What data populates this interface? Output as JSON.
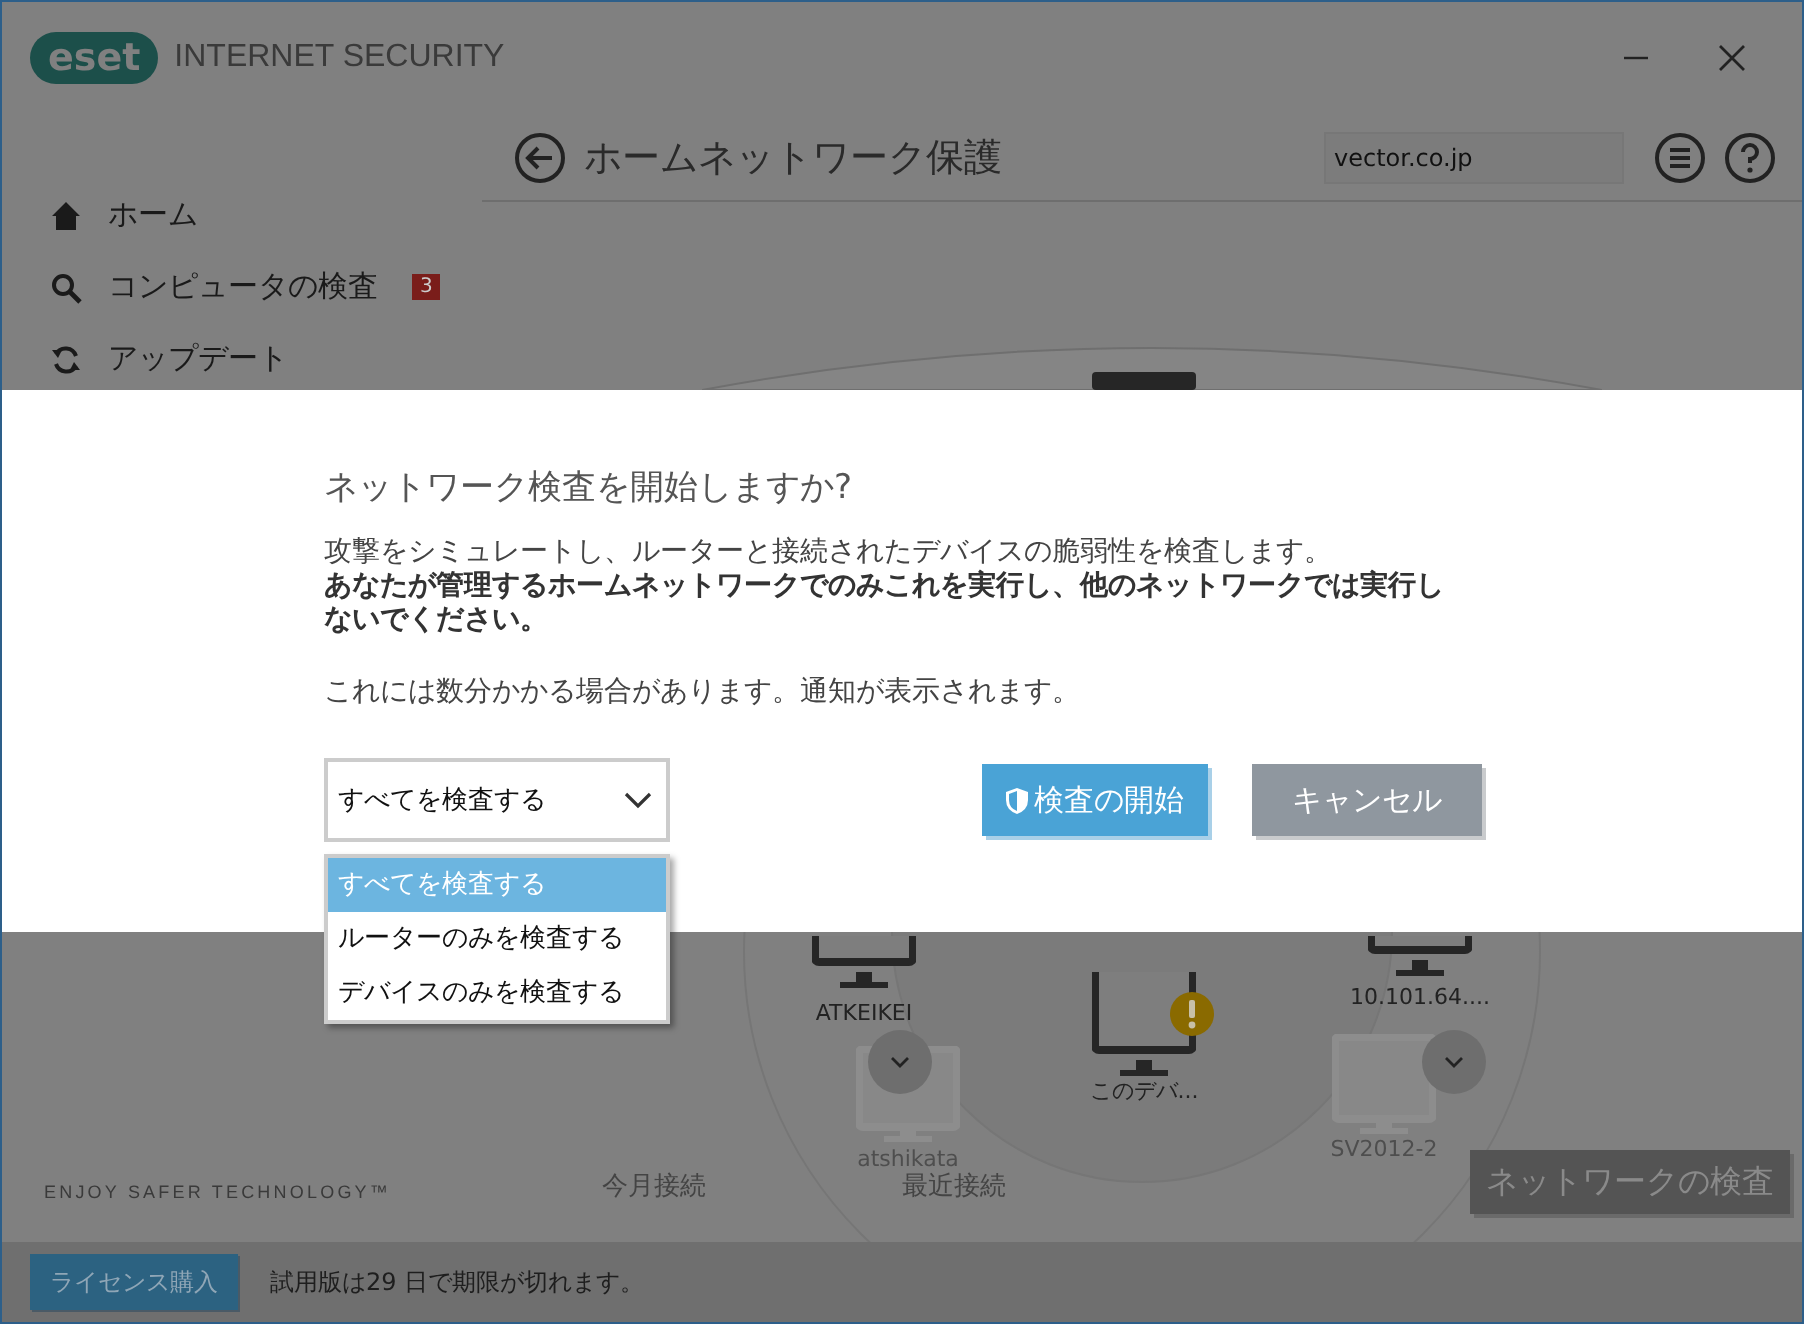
{
  "app": {
    "logo": "eset",
    "product": "INTERNET SECURITY"
  },
  "sidebar": {
    "items": [
      {
        "label": "ホーム"
      },
      {
        "label": "コンピュータの検査",
        "badge": "3"
      },
      {
        "label": "アップデート"
      }
    ]
  },
  "page": {
    "title": "ホームネットワーク保護",
    "search_value": "vector.co.jp"
  },
  "dialog": {
    "title": "ネットワーク検査を開始しますか?",
    "text": "攻撃をシミュレートし、ルーターと接続されたデバイスの脆弱性を検査します。",
    "warning": "あなたが管理するホームネットワークでのみこれを実行し、他のネットワークでは実行しないでください。",
    "note": "これには数分かかる場合があります。通知が表示されます。",
    "scope_select": {
      "value": "すべてを検査する",
      "options": [
        {
          "label": "すべてを検査する",
          "selected": true
        },
        {
          "label": "ルーターのみを検査する",
          "selected": false
        },
        {
          "label": "デバイスのみを検査する",
          "selected": false
        }
      ]
    },
    "buttons": [
      {
        "label": "検査の開始",
        "kind": "primary"
      },
      {
        "label": "キャンセル",
        "kind": "secondary"
      }
    ]
  },
  "network_map": {
    "devices": [
      {
        "label": "ATKEIKEI",
        "faded": false,
        "warning": false
      },
      {
        "label": "10.101.64....",
        "faded": false,
        "warning": false
      },
      {
        "label": "このデバ...",
        "faded": false,
        "warning": true
      },
      {
        "label": "atshikata",
        "faded": true,
        "warning": false
      },
      {
        "label": "SV2012-2",
        "faded": true,
        "warning": false
      }
    ],
    "tabs": [
      {
        "label": "今月接続"
      },
      {
        "label": "最近接続"
      }
    ]
  },
  "tagline": "ENJOY SAFER TECHNOLOGY™",
  "scan_button": "ネットワークの検査",
  "status_bar": {
    "button": "ライセンス購入",
    "message": "試用版は29 日で期限が切れます。"
  }
}
